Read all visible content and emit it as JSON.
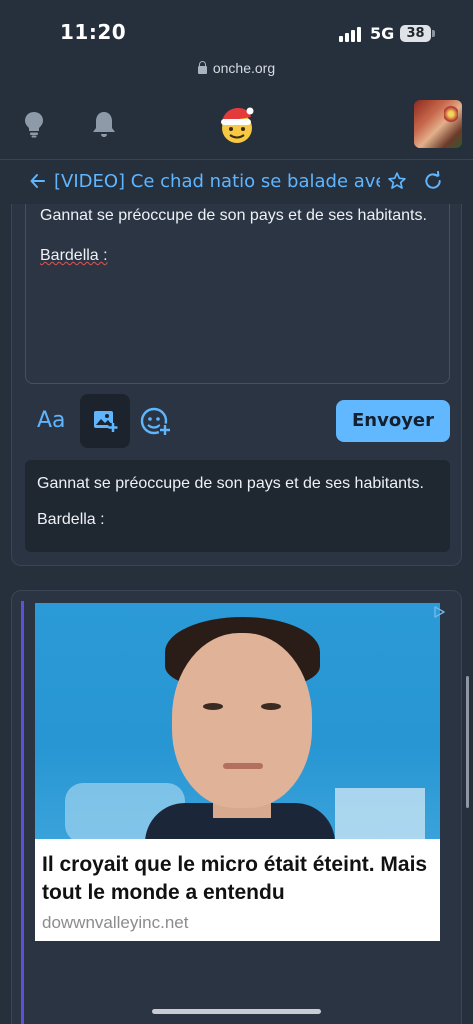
{
  "status_bar": {
    "time": "11:20",
    "network": "5G",
    "battery": "38"
  },
  "browser": {
    "url": "onche.org"
  },
  "header": {
    "icons": [
      "bulb-icon",
      "bell-icon",
      "santa-smiley-logo",
      "user-avatar"
    ]
  },
  "topic": {
    "title": "[VIDEO] Ce chad natio se balade avec V"
  },
  "editor": {
    "line1": "Gannat se préoccupe de son pays et de ses habitants.",
    "line2": "Bardella :"
  },
  "toolbar": {
    "format_label": "Aa",
    "send_label": "Envoyer"
  },
  "preview": {
    "line1": "Gannat se préoccupe de son pays et de ses habitants.",
    "line2": "Bardella :"
  },
  "ad": {
    "headline": "Il croyait que le micro était éteint. Mais tout le monde a entendu",
    "domain": "dowwnvalleyinc.net"
  },
  "colors": {
    "background": "#262f3c",
    "accent": "#5fb6ff",
    "send_button": "#62b8ff"
  }
}
